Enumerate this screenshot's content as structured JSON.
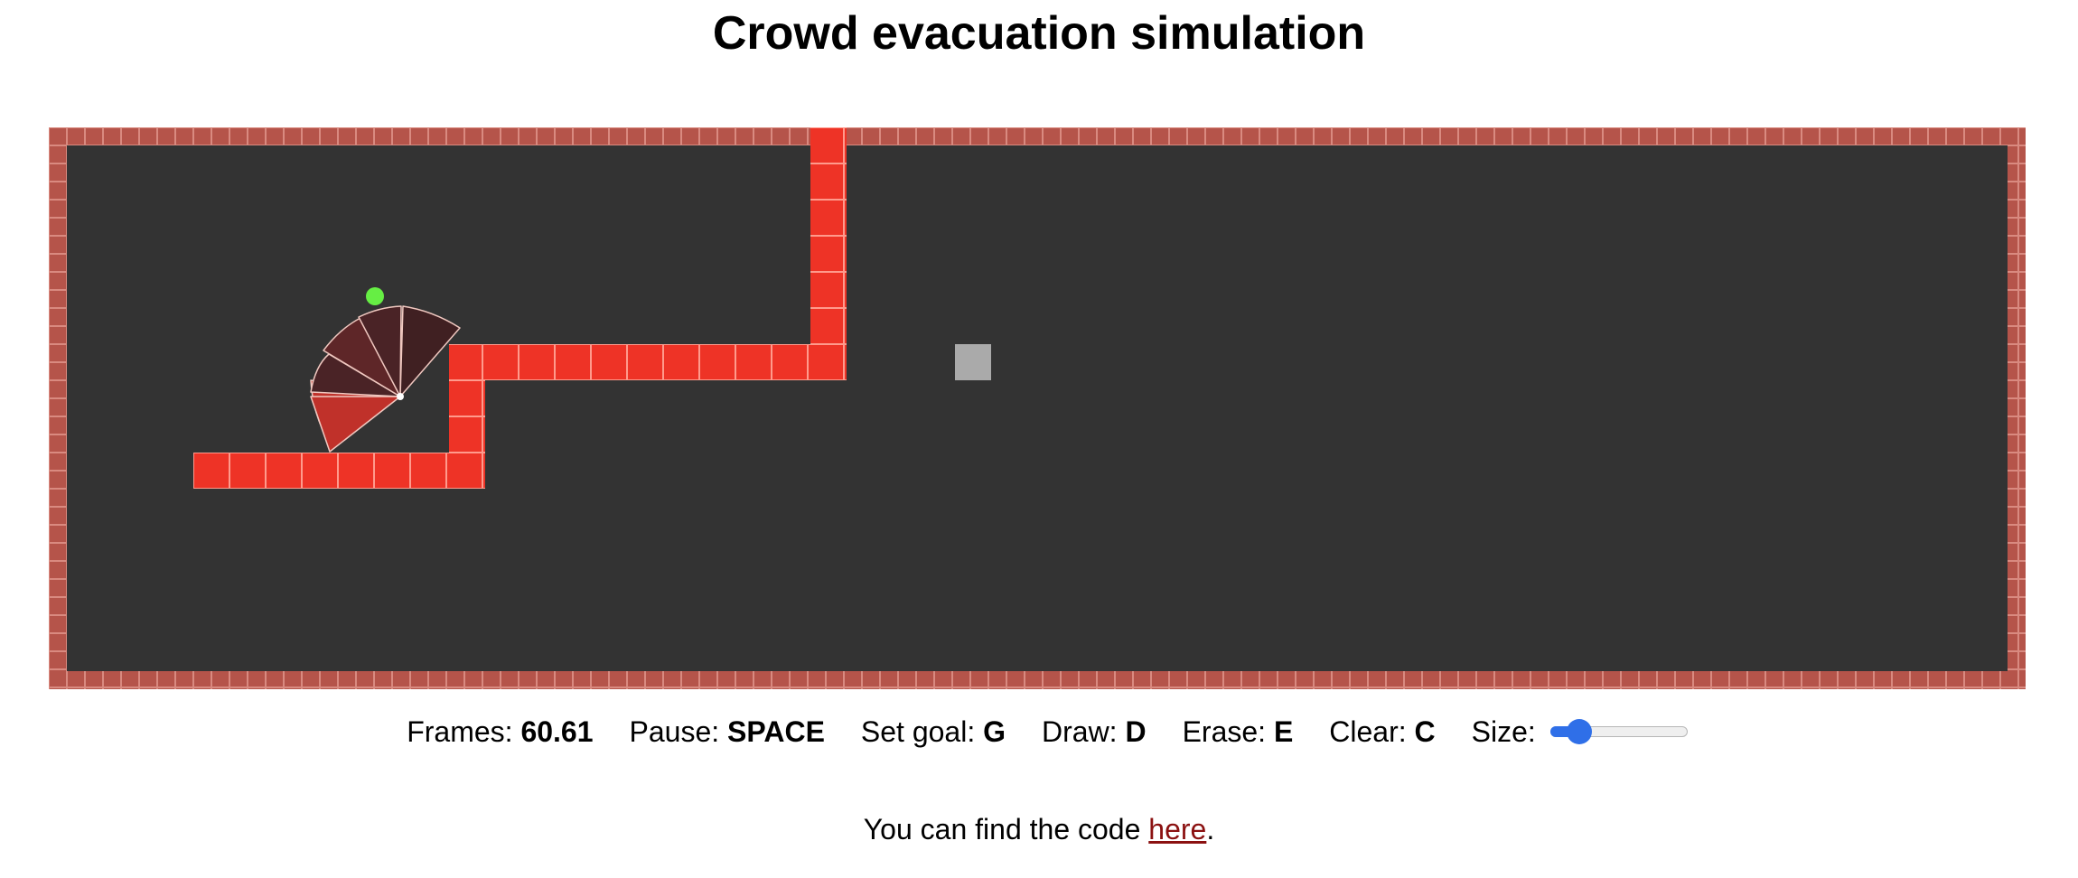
{
  "title": "Crowd evacuation simulation",
  "controls": {
    "frames_label": "Frames:",
    "frames_value": "60.61",
    "pause_label": "Pause:",
    "pause_key": "SPACE",
    "goal_label": "Set goal:",
    "goal_key": "G",
    "draw_label": "Draw:",
    "draw_key": "D",
    "erase_label": "Erase:",
    "erase_key": "E",
    "clear_label": "Clear:",
    "clear_key": "C",
    "size_label": "Size:",
    "size_value": 0.15
  },
  "footer": {
    "prefix": "You can find the code ",
    "link_text": "here",
    "suffix": "."
  },
  "colors": {
    "floor": "#333333",
    "wall": "#b5544a",
    "obstacle": "#ee3326",
    "goal": "#aaaaaa",
    "agent": "#66ee44",
    "accent": "#2f6fe8",
    "link": "#8b1111"
  }
}
